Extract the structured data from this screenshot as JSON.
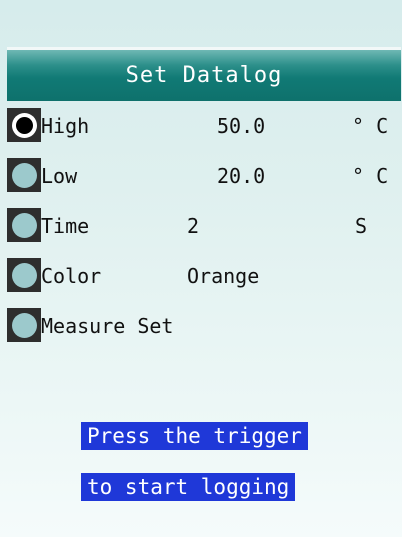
{
  "title": "Set Datalog",
  "items": [
    {
      "label": "High",
      "value": "50.0",
      "unit": "° C",
      "selected": true
    },
    {
      "label": "Low",
      "value": "20.0",
      "unit": "° C",
      "selected": false
    },
    {
      "label": "Time",
      "value": "2",
      "unit": "S",
      "selected": false
    },
    {
      "label": "Color",
      "value": "Orange",
      "unit": "",
      "selected": false
    },
    {
      "label": "Measure Set",
      "value": "",
      "unit": "",
      "selected": false
    }
  ],
  "message": {
    "line1": "Press the trigger",
    "line2": "to start logging"
  },
  "colors": {
    "title_bar": "#117a75",
    "message_bg": "#1f38d8",
    "radio_fill": "#9cc9cc"
  }
}
